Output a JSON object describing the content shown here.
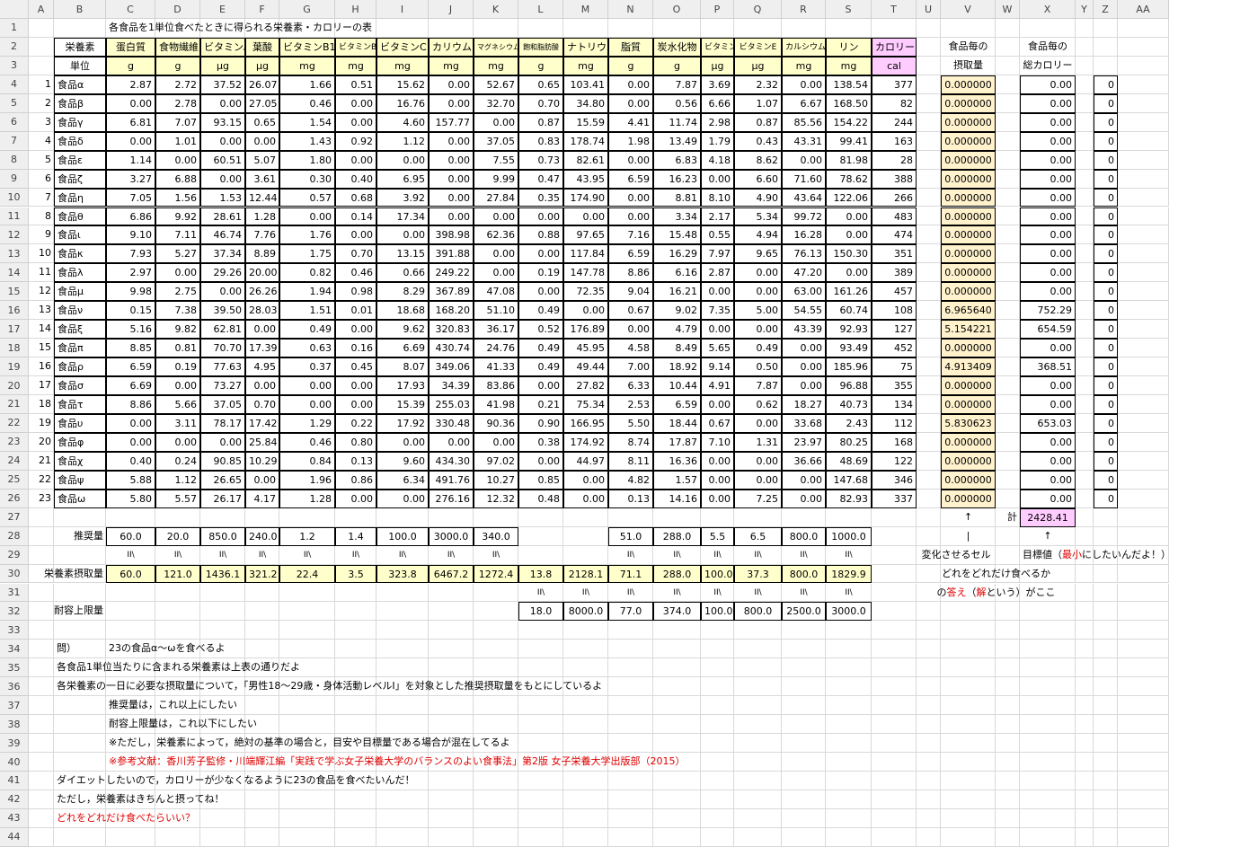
{
  "title": "各食品を1単位食べたときに得られる栄養素・カロリーの表",
  "columns": [
    "A",
    "B",
    "C",
    "D",
    "E",
    "F",
    "G",
    "H",
    "I",
    "J",
    "K",
    "L",
    "M",
    "N",
    "O",
    "P",
    "Q",
    "R",
    "S",
    "T",
    "U",
    "V",
    "W",
    "X",
    "Y",
    "Z",
    "AA"
  ],
  "rows": [
    "1",
    "2",
    "3",
    "4",
    "5",
    "6",
    "7",
    "8",
    "9",
    "10",
    "11",
    "12",
    "13",
    "14",
    "15",
    "16",
    "17",
    "18",
    "19",
    "20",
    "21",
    "22",
    "23",
    "24",
    "25",
    "26",
    "27",
    "28",
    "29",
    "30",
    "31",
    "32",
    "33",
    "34",
    "35",
    "36",
    "37",
    "38",
    "39",
    "40",
    "41",
    "42",
    "43",
    "44"
  ],
  "labels": {
    "nutrient": "栄養素",
    "unit": "単位",
    "intake_header_1": "食品毎の",
    "intake_header_2": "摂取量",
    "cal_header_1": "食品毎の",
    "cal_header_2": "総カロリー",
    "recommended": "推奨量",
    "nutrient_intake": "栄養素摂取量",
    "upper_limit": "耐容上限量",
    "total": "計",
    "up_arrow": "↑",
    "down_arrow": "|",
    "changing_cell": "変化させるセル",
    "target_prefix": "目標値（",
    "target_min": "最小",
    "target_suffix": "にしたいんだよ！）",
    "which_how_much": "どれをどれだけ食べるか",
    "answer_prefix": "の",
    "answer_word": "答え",
    "answer_mid": "（",
    "answer_sol": "解",
    "answer_suffix": "という）がここ",
    "gte": "II\\",
    "lte": "II\\"
  },
  "nutrients": [
    "蛋白質",
    "食物繊維",
    "ビタミンA",
    "葉酸",
    "ビタミンB1",
    "ビタミンB2",
    "ビタミンC",
    "カリウム",
    "マグネシウム",
    "飽和脂肪酸",
    "ナトリウム",
    "脂質",
    "炭水化物",
    "ビタミンD",
    "ビタミンE",
    "カルシウム",
    "リン",
    "カロリー"
  ],
  "units": [
    "g",
    "g",
    "μg",
    "μg",
    "mg",
    "mg",
    "mg",
    "mg",
    "mg",
    "g",
    "mg",
    "g",
    "g",
    "μg",
    "μg",
    "mg",
    "mg",
    "cal"
  ],
  "foods": [
    {
      "no": "1",
      "name": "食品α",
      "v": [
        "2.87",
        "2.72",
        "37.52",
        "26.07",
        "1.66",
        "0.51",
        "15.62",
        "0.00",
        "52.67",
        "0.65",
        "103.41",
        "0.00",
        "7.87",
        "3.69",
        "2.32",
        "0.00",
        "138.54",
        "377"
      ],
      "intake": "0.000000",
      "cal": "0.00",
      "z": "0"
    },
    {
      "no": "2",
      "name": "食品β",
      "v": [
        "0.00",
        "2.78",
        "0.00",
        "27.05",
        "0.46",
        "0.00",
        "16.76",
        "0.00",
        "32.70",
        "0.70",
        "34.80",
        "0.00",
        "0.56",
        "6.66",
        "1.07",
        "6.67",
        "168.50",
        "82"
      ],
      "intake": "0.000000",
      "cal": "0.00",
      "z": "0"
    },
    {
      "no": "3",
      "name": "食品γ",
      "v": [
        "6.81",
        "7.07",
        "93.15",
        "0.65",
        "1.54",
        "0.00",
        "4.60",
        "157.77",
        "0.00",
        "0.87",
        "15.59",
        "4.41",
        "11.74",
        "2.98",
        "0.87",
        "85.56",
        "154.22",
        "244"
      ],
      "intake": "0.000000",
      "cal": "0.00",
      "z": "0"
    },
    {
      "no": "4",
      "name": "食品δ",
      "v": [
        "0.00",
        "1.01",
        "0.00",
        "0.00",
        "1.43",
        "0.92",
        "1.12",
        "0.00",
        "37.05",
        "0.83",
        "178.74",
        "1.98",
        "13.49",
        "1.79",
        "0.43",
        "43.31",
        "99.41",
        "163"
      ],
      "intake": "0.000000",
      "cal": "0.00",
      "z": "0"
    },
    {
      "no": "5",
      "name": "食品ε",
      "v": [
        "1.14",
        "0.00",
        "60.51",
        "5.07",
        "1.80",
        "0.00",
        "0.00",
        "0.00",
        "7.55",
        "0.73",
        "82.61",
        "0.00",
        "6.83",
        "4.18",
        "8.62",
        "0.00",
        "81.98",
        "28"
      ],
      "intake": "0.000000",
      "cal": "0.00",
      "z": "0"
    },
    {
      "no": "6",
      "name": "食品ζ",
      "v": [
        "3.27",
        "6.88",
        "0.00",
        "3.61",
        "0.30",
        "0.40",
        "6.95",
        "0.00",
        "9.99",
        "0.47",
        "43.95",
        "6.59",
        "16.23",
        "0.00",
        "6.60",
        "71.60",
        "78.62",
        "388"
      ],
      "intake": "0.000000",
      "cal": "0.00",
      "z": "0"
    },
    {
      "no": "7",
      "name": "食品η",
      "v": [
        "7.05",
        "1.56",
        "1.53",
        "12.44",
        "0.57",
        "0.68",
        "3.92",
        "0.00",
        "27.84",
        "0.35",
        "174.90",
        "0.00",
        "8.81",
        "8.10",
        "4.90",
        "43.64",
        "122.06",
        "266"
      ],
      "intake": "0.000000",
      "cal": "0.00",
      "z": "0"
    },
    {
      "no": "8",
      "name": "食品θ",
      "v": [
        "6.86",
        "9.92",
        "28.61",
        "1.28",
        "0.00",
        "0.14",
        "17.34",
        "0.00",
        "0.00",
        "0.00",
        "0.00",
        "0.00",
        "3.34",
        "2.17",
        "5.34",
        "99.72",
        "0.00",
        "483"
      ],
      "intake": "0.000000",
      "cal": "0.00",
      "z": "0"
    },
    {
      "no": "9",
      "name": "食品ι",
      "v": [
        "9.10",
        "7.11",
        "46.74",
        "7.76",
        "1.76",
        "0.00",
        "0.00",
        "398.98",
        "62.36",
        "0.88",
        "97.65",
        "7.16",
        "15.48",
        "0.55",
        "4.94",
        "16.28",
        "0.00",
        "474"
      ],
      "intake": "0.000000",
      "cal": "0.00",
      "z": "0"
    },
    {
      "no": "10",
      "name": "食品κ",
      "v": [
        "7.93",
        "5.27",
        "37.34",
        "8.89",
        "1.75",
        "0.70",
        "13.15",
        "391.88",
        "0.00",
        "0.00",
        "117.84",
        "6.59",
        "16.29",
        "7.97",
        "9.65",
        "76.13",
        "150.30",
        "351"
      ],
      "intake": "0.000000",
      "cal": "0.00",
      "z": "0"
    },
    {
      "no": "11",
      "name": "食品λ",
      "v": [
        "2.97",
        "0.00",
        "29.26",
        "20.00",
        "0.82",
        "0.46",
        "0.66",
        "249.22",
        "0.00",
        "0.19",
        "147.78",
        "8.86",
        "6.16",
        "2.87",
        "0.00",
        "47.20",
        "0.00",
        "389"
      ],
      "intake": "0.000000",
      "cal": "0.00",
      "z": "0"
    },
    {
      "no": "12",
      "name": "食品μ",
      "v": [
        "9.98",
        "2.75",
        "0.00",
        "26.26",
        "1.94",
        "0.98",
        "8.29",
        "367.89",
        "47.08",
        "0.00",
        "72.35",
        "9.04",
        "16.21",
        "0.00",
        "0.00",
        "63.00",
        "161.26",
        "457"
      ],
      "intake": "0.000000",
      "cal": "0.00",
      "z": "0"
    },
    {
      "no": "13",
      "name": "食品ν",
      "v": [
        "0.15",
        "7.38",
        "39.50",
        "28.03",
        "1.51",
        "0.01",
        "18.68",
        "168.20",
        "51.10",
        "0.49",
        "0.00",
        "0.67",
        "9.02",
        "7.35",
        "5.00",
        "54.55",
        "60.74",
        "108"
      ],
      "intake": "6.965640",
      "cal": "752.29",
      "z": "0"
    },
    {
      "no": "14",
      "name": "食品ξ",
      "v": [
        "5.16",
        "9.82",
        "62.81",
        "0.00",
        "0.49",
        "0.00",
        "9.62",
        "320.83",
        "36.17",
        "0.52",
        "176.89",
        "0.00",
        "4.79",
        "0.00",
        "0.00",
        "43.39",
        "92.93",
        "127"
      ],
      "intake": "5.154221",
      "cal": "654.59",
      "z": "0"
    },
    {
      "no": "15",
      "name": "食品π",
      "v": [
        "8.85",
        "0.81",
        "70.70",
        "17.39",
        "0.63",
        "0.16",
        "6.69",
        "430.74",
        "24.76",
        "0.49",
        "45.95",
        "4.58",
        "8.49",
        "5.65",
        "0.49",
        "0.00",
        "93.49",
        "452"
      ],
      "intake": "0.000000",
      "cal": "0.00",
      "z": "0"
    },
    {
      "no": "16",
      "name": "食品ρ",
      "v": [
        "6.59",
        "0.19",
        "77.63",
        "4.95",
        "0.37",
        "0.45",
        "8.07",
        "349.06",
        "41.33",
        "0.49",
        "49.44",
        "7.00",
        "18.92",
        "9.14",
        "0.50",
        "0.00",
        "185.96",
        "75"
      ],
      "intake": "4.913409",
      "cal": "368.51",
      "z": "0"
    },
    {
      "no": "17",
      "name": "食品σ",
      "v": [
        "6.69",
        "0.00",
        "73.27",
        "0.00",
        "0.00",
        "0.00",
        "17.93",
        "34.39",
        "83.86",
        "0.00",
        "27.82",
        "6.33",
        "10.44",
        "4.91",
        "7.87",
        "0.00",
        "96.88",
        "355"
      ],
      "intake": "0.000000",
      "cal": "0.00",
      "z": "0"
    },
    {
      "no": "18",
      "name": "食品τ",
      "v": [
        "8.86",
        "5.66",
        "37.05",
        "0.70",
        "0.00",
        "0.00",
        "15.39",
        "255.03",
        "41.98",
        "0.21",
        "75.34",
        "2.53",
        "6.59",
        "0.00",
        "0.62",
        "18.27",
        "40.73",
        "134"
      ],
      "intake": "0.000000",
      "cal": "0.00",
      "z": "0"
    },
    {
      "no": "19",
      "name": "食品υ",
      "v": [
        "0.00",
        "3.11",
        "78.17",
        "17.42",
        "1.29",
        "0.22",
        "17.92",
        "330.48",
        "90.36",
        "0.90",
        "166.95",
        "5.50",
        "18.44",
        "0.67",
        "0.00",
        "33.68",
        "2.43",
        "112"
      ],
      "intake": "5.830623",
      "cal": "653.03",
      "z": "0"
    },
    {
      "no": "20",
      "name": "食品φ",
      "v": [
        "0.00",
        "0.00",
        "0.00",
        "25.84",
        "0.46",
        "0.80",
        "0.00",
        "0.00",
        "0.00",
        "0.38",
        "174.92",
        "8.74",
        "17.87",
        "7.10",
        "1.31",
        "23.97",
        "80.25",
        "168"
      ],
      "intake": "0.000000",
      "cal": "0.00",
      "z": "0"
    },
    {
      "no": "21",
      "name": "食品χ",
      "v": [
        "0.40",
        "0.24",
        "90.85",
        "10.29",
        "0.84",
        "0.13",
        "9.60",
        "434.30",
        "97.02",
        "0.00",
        "44.97",
        "8.11",
        "16.36",
        "0.00",
        "0.00",
        "36.66",
        "48.69",
        "122"
      ],
      "intake": "0.000000",
      "cal": "0.00",
      "z": "0"
    },
    {
      "no": "22",
      "name": "食品ψ",
      "v": [
        "5.88",
        "1.12",
        "26.65",
        "0.00",
        "1.96",
        "0.86",
        "6.34",
        "491.76",
        "10.27",
        "0.85",
        "0.00",
        "4.82",
        "1.57",
        "0.00",
        "0.00",
        "0.00",
        "147.68",
        "346"
      ],
      "intake": "0.000000",
      "cal": "0.00",
      "z": "0"
    },
    {
      "no": "23",
      "name": "食品ω",
      "v": [
        "5.80",
        "5.57",
        "26.17",
        "4.17",
        "1.28",
        "0.00",
        "0.00",
        "276.16",
        "12.32",
        "0.48",
        "0.00",
        "0.13",
        "14.16",
        "0.00",
        "7.25",
        "0.00",
        "82.93",
        "337"
      ],
      "intake": "0.000000",
      "cal": "0.00",
      "z": "0"
    }
  ],
  "total_cal": "2428.41",
  "recommended": [
    "60.0",
    "20.0",
    "850.0",
    "240.0",
    "1.2",
    "1.4",
    "100.0",
    "3000.0",
    "340.0",
    "",
    "",
    "51.0",
    "288.0",
    "5.5",
    "6.5",
    "800.0",
    "1000.0"
  ],
  "intake": [
    "60.0",
    "121.0",
    "1436.1",
    "321.2",
    "22.4",
    "3.5",
    "323.8",
    "6467.2",
    "1272.4",
    "13.8",
    "2128.1",
    "71.1",
    "288.0",
    "100.0",
    "37.3",
    "800.0",
    "1829.9"
  ],
  "upper": [
    "",
    "",
    "",
    "",
    "",
    "",
    "",
    "",
    "",
    "18.0",
    "8000.0",
    "77.0",
    "374.0",
    "100.0",
    "800.0",
    "2500.0",
    "3000.0"
  ],
  "notes": {
    "r34a": "問）",
    "r34b": "23の食品α～ωを食べるよ",
    "r35": "各食品1単位当たりに含まれる栄養素は上表の通りだよ",
    "r36": "各栄養素の一日に必要な摂取量について，「男性18～29歳・身体活動レベルⅠ」を対象とした推奨摂取量をもとにしているよ",
    "r37": "推奨量は，これ以上にしたい",
    "r38": "耐容上限量は，これ以下にしたい",
    "r39": "※ただし，栄養素によって，絶対の基準の場合と，目安や目標量である場合が混在してるよ",
    "r40": "※参考文献：香川芳子監修・川端輝江編「実践で学ぶ女子栄養大学のバランスのよい食事法」第2版 女子栄養大学出版部（2015）",
    "r41": "ダイエットしたいので，カロリーが少なくなるように23の食品を食べたいんだ！",
    "r42": "ただし，栄養素はきちんと摂ってね！",
    "r43": "どれをどれだけ食べたらいい？"
  },
  "colors": {
    "yellow": "#ffffcc",
    "orange": "#fff2cc",
    "pink": "#ffccff",
    "red": "#e00000",
    "header": "#efefef"
  }
}
